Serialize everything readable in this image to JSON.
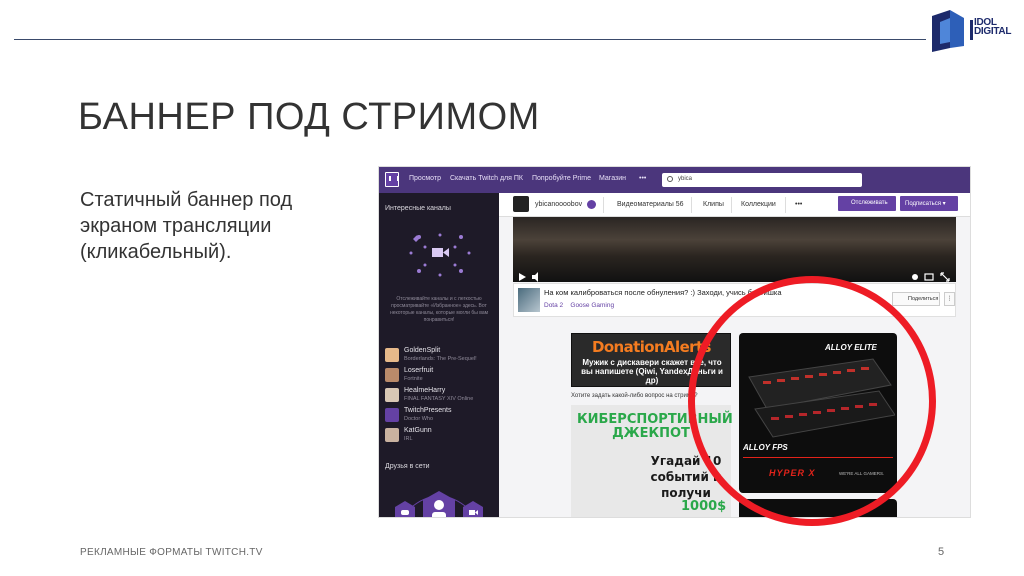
{
  "brand": {
    "logo_line1": "IDOL",
    "logo_line2": "DIGITAL"
  },
  "slide": {
    "title": "БАННЕР ПОД СТРИМОМ",
    "description": "Статичный баннер под экраном трансляции (кликабельный).",
    "footer_left": "РЕКЛАМНЫЕ ФОРМАТЫ TWITCH.TV",
    "page_number": "5"
  },
  "colors": {
    "twitch_purple": "#6441a4",
    "topbar": "#4b367c",
    "sidebar": "#1e1a28",
    "highlight_circle": "#ee1c25"
  },
  "twitch": {
    "nav": [
      "Просмотр",
      "Скачать Twitch для ПК",
      "Попробуйте Prime",
      "Магазин",
      "•••"
    ],
    "search_value": "ybica",
    "sidebar": {
      "featured_heading": "Интересные каналы",
      "note": "Отслеживайте каналы и с легкостью просматривайте «Избранное» здесь. Вот некоторые каналы, которые могли бы вам понравиться!",
      "channels": [
        {
          "name": "GoldenSplit",
          "game": "Borderlands: The Pre-Sequel!"
        },
        {
          "name": "Loserfruit",
          "game": "Fortnite"
        },
        {
          "name": "HealmeHarry",
          "game": "FINAL FANTASY XIV Online"
        },
        {
          "name": "TwitchPresents",
          "game": "Doctor Who"
        },
        {
          "name": "KatGunn",
          "game": "IRL"
        }
      ],
      "friends_heading": "Друзья в сети"
    },
    "channel_bar": {
      "name": "ybicanoooobov",
      "tabs": [
        "Видеоматериалы 56",
        "Клипы",
        "Коллекции",
        "•••"
      ],
      "follow": "Отслеживать",
      "subscribe": "Подписаться ▾"
    },
    "stream_info": {
      "title": "На ком калиброваться после обнуления? :) Заходи, учись братишка",
      "game": "Dota 2",
      "team": "Goose Gaming",
      "share": "Поделиться",
      "more": "⋮"
    },
    "panels": {
      "donation_title": "DonationAlerts",
      "donation_text": "Мужик с дискавери скажет все, что вы напишете (Qiwi, YandexДеньги и др)",
      "ask_text": "Хотите задать какой-либо вопрос на стриме?",
      "jackpot_title": "КИБЕРСПОРТИВНЫЙ ДЖЕКПОТ",
      "jackpot_text": "Угадай 10 событий и получи",
      "jackpot_amount": "1000$",
      "hyperx_top": "ALLOY ELITE",
      "hyperx_bottom": "ALLOY FPS",
      "hyperx_brand": "HYPER X",
      "hyperx_tag": "WE'RE ALL GAMERS."
    }
  }
}
